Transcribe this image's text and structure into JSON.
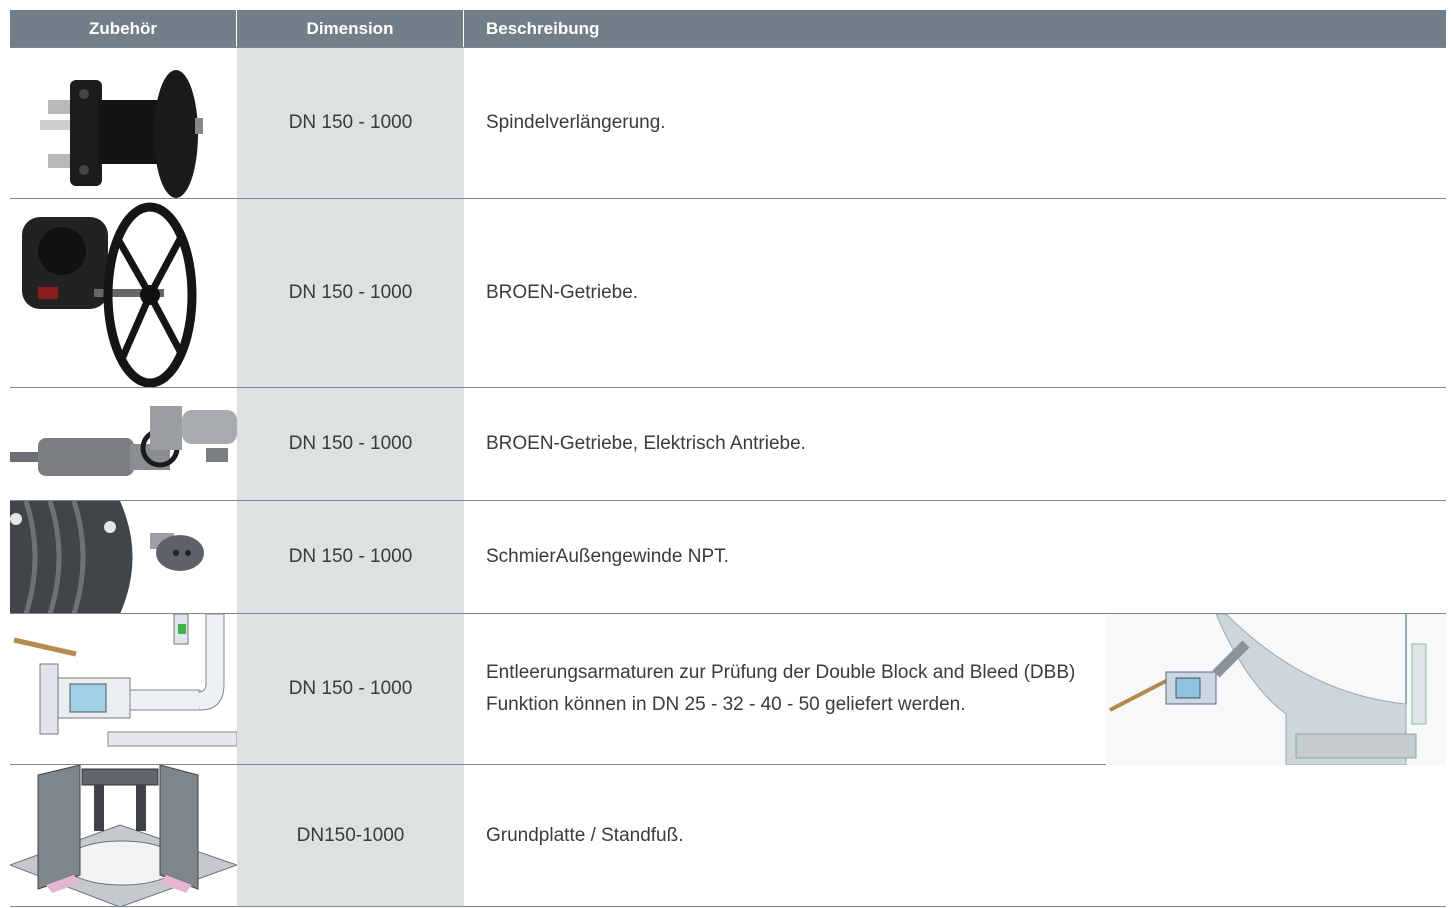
{
  "header": {
    "col1": "Zubehör",
    "col2": "Dimension",
    "col3": "Beschreibung"
  },
  "rows": [
    {
      "icon": "spindle-extension-image",
      "dimension": "DN 150 - 1000",
      "description": "Spindelverlängerung."
    },
    {
      "icon": "gearbox-handwheel-image",
      "dimension": "DN 150 - 1000",
      "description": "BROEN-Getriebe."
    },
    {
      "icon": "electric-actuator-image",
      "dimension": "DN 150 - 1000",
      "description": "BROEN-Getriebe, Elektrisch Antriebe."
    },
    {
      "icon": "grease-nipple-image",
      "dimension": "DN 150 - 1000",
      "description": "SchmierAußengewinde NPT."
    },
    {
      "icon": "drain-valve-image",
      "dimension": "DN 150 - 1000",
      "description": "Entleerungsarmaturen zur Prüfung der Double Block and Bleed (DBB) Funktion können in DN 25 - 32 - 40 - 50 geliefert werden."
    },
    {
      "icon": "base-plate-image",
      "dimension": "DN150-1000",
      "description": "Grundplatte / Standfuß."
    }
  ],
  "colors": {
    "header_bg": "#737f88",
    "dimension_bg": "#dde1e1",
    "border": "#7d8790"
  }
}
